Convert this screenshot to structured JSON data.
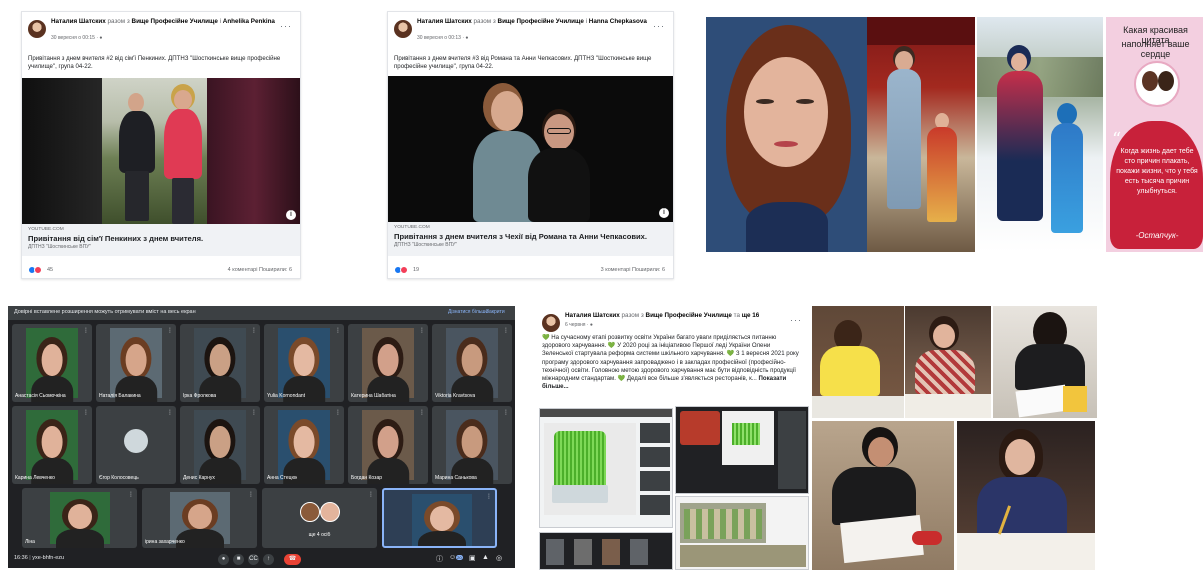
{
  "posts": {
    "post1": {
      "author": "Наталия Шатских",
      "with_prefix": "разом з",
      "page": "Вище Професійне Училище",
      "and_word": "і",
      "tagged": "Anhelika Penkina",
      "date": "30 вересня о 00:15 · ",
      "privacy_icon": "globe-icon",
      "text": "Привітання з днем вчителя #2 від сім'ї Пенкиних. ДПТНЗ \"Шосткинське вище професійне училище\", група 04-22.",
      "link_source": "YOUTUBE.COM",
      "link_title": "Привітання від сім'ї Пенкиних з днем вчителя.",
      "link_subtitle": "ДПТНЗ \"Шосткинське ВПУ\"",
      "reactions_count": "45",
      "stats": "4 коментарі  Поширили: 6"
    },
    "post2": {
      "author": "Наталия Шатских",
      "with_prefix": "разом з",
      "page": "Вище Професійне Училище",
      "and_word": "і",
      "tagged": "Hanna Chepkasova",
      "date": "30 вересня о 00:13 · ",
      "privacy_icon": "globe-icon",
      "text": "Привітання з днем вчителя #3 від Романа та Анни Чепкасових. ДПТНЗ \"Шосткинське вище професійне училище\", група 04-22.",
      "link_source": "YOUTUBE.COM",
      "link_title": "Привітання з днем вчителя з Чехії від Романа та Анни Чепкасових.",
      "link_subtitle": "ДПТНЗ \"Шосткинське ВПУ\"",
      "reactions_count": "19",
      "stats": "3 коментарі  Поширили: 6"
    },
    "post4": {
      "author": "Наталия Шатских",
      "with_prefix": "разом з",
      "page": "Вище Професійне Училище",
      "and_word": "та",
      "tagged": "ще 16",
      "date": "6 червня · ",
      "privacy_icon": "globe-icon",
      "text": "💚 На сучасному етапі розвитку освіти України багато уваги приділяється питанню здорового харчування. 💚 У 2020 році за ініціативою Першої леді України Олени Зеленської стартувала реформа системи шкільного харчування. 💚 З 1 вересня 2021 року програму здорового харчування запроваджено і в закладах професійної (професійно-технічної) освіти. Головною метою здорового харчування має бути відповідність продукції міжнародним стандартам. 💚 Дедалі все більше з'являється ресторанів, к...",
      "see_more": "Показати більше..."
    }
  },
  "quote_card": {
    "line1": "Какая красивая цитата",
    "line2": "наполняет ваше сердце",
    "body": "Когда жизнь дает тебе сто причин плакать, покажи жизни, что у тебя есть тысяча причин улыбнуться.",
    "signature": "-Остапчук-"
  },
  "meet": {
    "banner": "Довірні вставлене розширення можуть отримувати вміст на весь екран",
    "banner_btn1": "Дізнатися більше",
    "banner_btn2": "Закрити",
    "participants": [
      "Анастасія Сьомочкіна",
      "Наталія Балакина",
      "Ірка Фролкова",
      "Yulia Kornondant",
      "Катерина Шабатіна",
      "Viktoria Kravtsova",
      "Карина Левченко",
      "Єгор Колосовець",
      "Денис Карнух",
      "Анна Стецюк",
      "Богдан Козар",
      "Марина Санькова",
      "Ліна",
      "ірина захарченко",
      "ще 4 осіб",
      ""
    ],
    "time": "16:36",
    "separator": "|",
    "code": "yxe-bhfn-ezu",
    "controls": [
      "mic-icon",
      "camera-icon",
      "captions-icon",
      "present-icon",
      "end-call-icon"
    ],
    "right_controls": [
      "info-icon",
      "people-icon",
      "chat-icon",
      "activities-icon",
      "host-controls-icon"
    ],
    "participant_badge": "20"
  },
  "colors": {
    "meet_bg": "#202124",
    "fb_blue": "#1877f2",
    "end_call": "#ea4335",
    "quote_pink": "#f3cfe0",
    "quote_heart": "#c8213a"
  }
}
